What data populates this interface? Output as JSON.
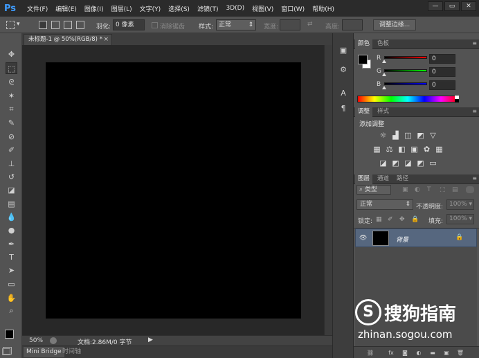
{
  "app": {
    "logo": "Ps"
  },
  "menu": [
    "文件(F)",
    "编辑(E)",
    "图像(I)",
    "图层(L)",
    "文字(Y)",
    "选择(S)",
    "滤镜(T)",
    "3D(D)",
    "视图(V)",
    "窗口(W)",
    "帮助(H)"
  ],
  "window_controls": {
    "minimize": "—",
    "restore": "▭",
    "close": "✕"
  },
  "options": {
    "feather_label": "羽化:",
    "feather_value": "0 像素",
    "antialias_label": "消除锯齿",
    "style_label": "样式:",
    "style_value": "正常",
    "width_label": "宽度:",
    "height_label": "高度:",
    "refine_button": "调整边缘..."
  },
  "document": {
    "tab_title": "未标题-1 @ 50%(RGB/8) *",
    "tab_close": "×"
  },
  "status": {
    "zoom": "50%",
    "doc_info": "文档:2.86M/0 字节"
  },
  "bottom_tabs": [
    "Mini Bridge",
    "时间轴"
  ],
  "color_panel": {
    "tabs": [
      "颜色",
      "色板"
    ],
    "channels": [
      {
        "label": "R",
        "value": "0",
        "color": "#ff0000"
      },
      {
        "label": "G",
        "value": "0",
        "color": "#00ff00"
      },
      {
        "label": "B",
        "value": "0",
        "color": "#0000ff"
      }
    ]
  },
  "adjust_panel": {
    "tabs": [
      "调整",
      "样式"
    ],
    "heading": "添加调整"
  },
  "layers_panel": {
    "tabs": [
      "图层",
      "通道",
      "路径"
    ],
    "filter_label": "类型",
    "blend_mode": "正常",
    "opacity_label": "不透明度:",
    "opacity_value": "100%",
    "lock_label": "锁定:",
    "fill_label": "填充:",
    "fill_value": "100%",
    "layers": [
      {
        "name": "背景",
        "visible": true,
        "locked": true
      }
    ]
  },
  "watermark": {
    "logo_char": "S",
    "name": "搜狗指南",
    "url": "zhinan.sogou.com"
  },
  "colors": {
    "foreground": "#000000",
    "background": "#ffffff",
    "canvas": "#000000",
    "selected_layer": "#56677f"
  }
}
